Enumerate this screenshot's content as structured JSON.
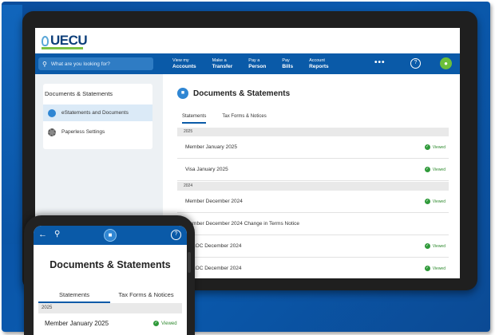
{
  "site": {
    "logo": "UECU"
  },
  "nav": {
    "search_placeholder": "What are you looking for?",
    "items": [
      {
        "top": "View my",
        "bottom": "Accounts"
      },
      {
        "top": "Make a",
        "bottom": "Transfer"
      },
      {
        "top": "Pay a",
        "bottom": "Person"
      },
      {
        "top": "Pay",
        "bottom": "Bills"
      },
      {
        "top": "Account",
        "bottom": "Reports"
      }
    ],
    "more": "•••"
  },
  "sidebar": {
    "title": "Documents & Statements",
    "items": [
      {
        "label": "eStatements and Documents"
      },
      {
        "label": "Paperless Settings"
      }
    ]
  },
  "main": {
    "title": "Documents & Statements",
    "tabs": [
      {
        "label": "Statements"
      },
      {
        "label": "Tax Forms & Notices"
      }
    ],
    "groups": [
      {
        "year": "2025",
        "rows": [
          {
            "label": "Member January 2025",
            "status": "Viewed"
          },
          {
            "label": "Visa January 2025",
            "status": "Viewed"
          }
        ]
      },
      {
        "year": "2024",
        "rows": [
          {
            "label": "Member December 2024",
            "status": "Viewed"
          },
          {
            "label": "Member December 2024 Change in Terms Notice",
            "status": ""
          },
          {
            "label": "HELOC December 2024",
            "status": "Viewed"
          },
          {
            "label": "HELOC December 2024",
            "status": "Viewed"
          }
        ]
      }
    ]
  },
  "phone": {
    "title": "Documents & Statements",
    "tabs": [
      {
        "label": "Statements"
      },
      {
        "label": "Tax Forms & Notices"
      }
    ],
    "year": "2025",
    "row": {
      "label": "Member January 2025",
      "status": "Viewed"
    }
  },
  "colors": {
    "brand_blue": "#0a5aa8",
    "accent_green": "#6cbf3a",
    "viewed_green": "#2f9a3a"
  }
}
